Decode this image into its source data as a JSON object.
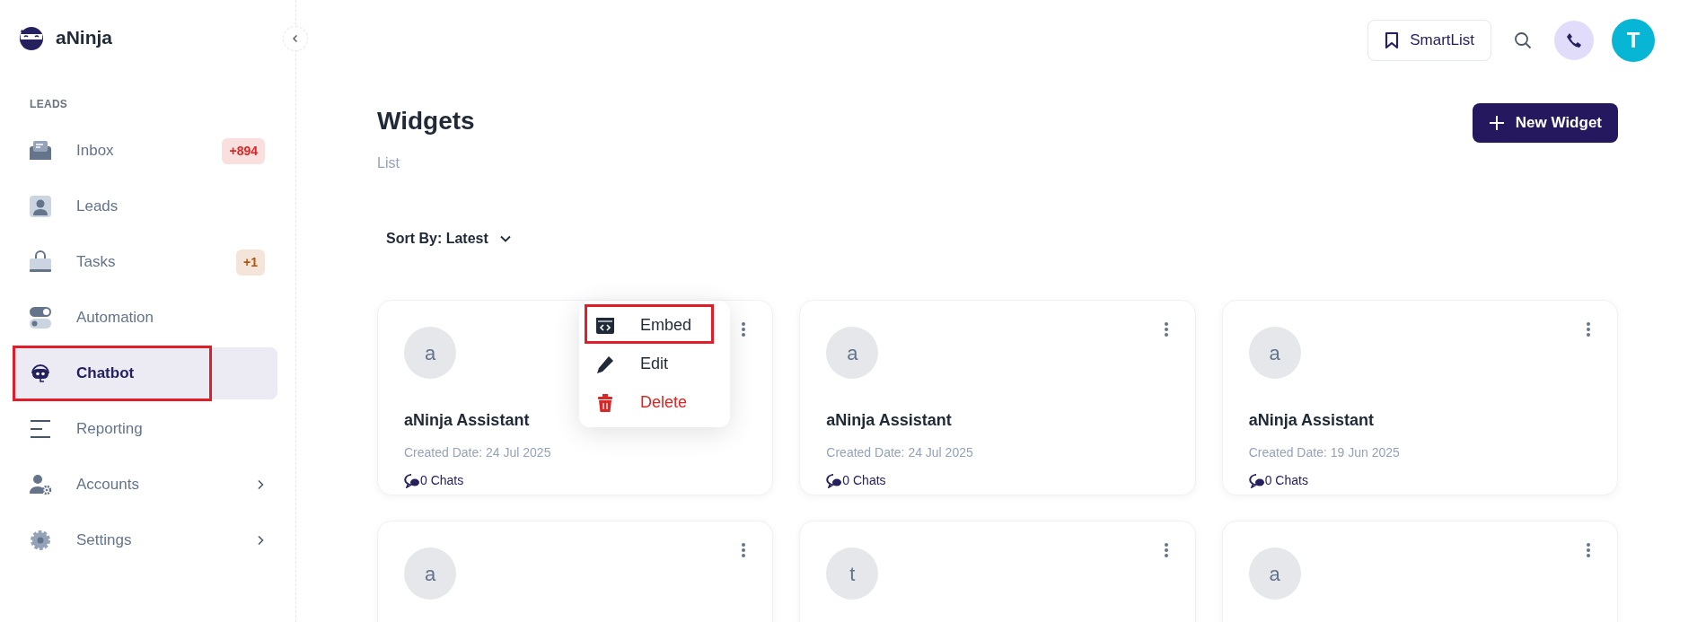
{
  "brand": {
    "name": "aNinja"
  },
  "sidebar": {
    "section": "LEADS",
    "items": [
      {
        "label": "Inbox",
        "badge": {
          "text": "+894",
          "color": "#dc2626"
        },
        "selected": false,
        "highlighted": false,
        "expandable": false
      },
      {
        "label": "Leads",
        "selected": false,
        "highlighted": false,
        "expandable": false
      },
      {
        "label": "Tasks",
        "badge": {
          "text": "+1",
          "color": "#b45309"
        },
        "selected": false,
        "highlighted": false,
        "expandable": false
      },
      {
        "label": "Automation",
        "selected": false,
        "highlighted": false,
        "expandable": false
      },
      {
        "label": "Chatbot",
        "selected": true,
        "highlighted": true,
        "expandable": false
      },
      {
        "label": "Reporting",
        "selected": false,
        "highlighted": false,
        "expandable": false
      },
      {
        "label": "Accounts",
        "selected": false,
        "highlighted": false,
        "expandable": true
      },
      {
        "label": "Settings",
        "selected": false,
        "highlighted": false,
        "expandable": true
      }
    ]
  },
  "header": {
    "smartlist": "SmartList",
    "avatar": "T"
  },
  "page": {
    "title": "Widgets",
    "subtitle": "List",
    "sort": "Sort By: Latest",
    "new_button": "New Widget"
  },
  "cards": [
    {
      "avatar": "a",
      "name": "aNinja Assistant",
      "date": "Created Date: 24 Jul 2025",
      "chats": "0 Chats",
      "menu_open": true
    },
    {
      "avatar": "a",
      "name": "aNinja Assistant",
      "date": "Created Date: 24 Jul 2025",
      "chats": "0 Chats",
      "menu_open": false
    },
    {
      "avatar": "a",
      "name": "aNinja Assistant",
      "date": "Created Date: 19 Jun 2025",
      "chats": "0 Chats",
      "menu_open": false
    },
    {
      "avatar": "a",
      "menu_open": false
    },
    {
      "avatar": "t",
      "menu_open": false
    },
    {
      "avatar": "a",
      "menu_open": false
    }
  ],
  "menu": {
    "items": [
      {
        "label": "Embed",
        "kind": "embed",
        "highlighted": true
      },
      {
        "label": "Edit",
        "kind": "edit",
        "highlighted": false
      },
      {
        "label": "Delete",
        "kind": "delete",
        "highlighted": false
      }
    ]
  }
}
